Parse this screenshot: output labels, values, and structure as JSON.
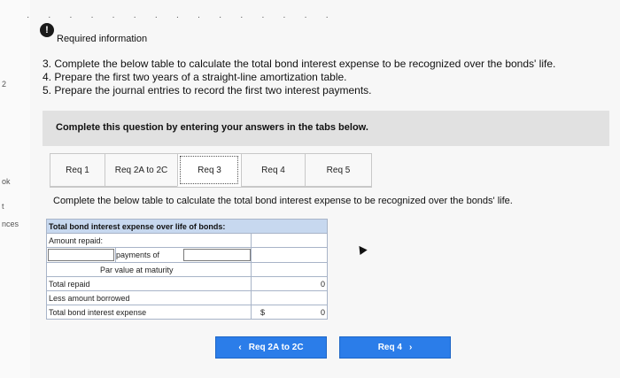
{
  "sidebar": {
    "fragments": [
      "2",
      "ok",
      "t",
      "nces"
    ]
  },
  "header": {
    "info_icon": "!",
    "required_info": "Required information"
  },
  "instructions": [
    "3. Complete the below table to calculate the total bond interest expense to be recognized over the bonds' life.",
    "4. Prepare the first two years of a straight-line amortization table.",
    "5. Prepare the journal entries to record the first two interest payments."
  ],
  "banner": "Complete this question by entering your answers in the tabs below.",
  "tabs": [
    {
      "label": "Req 1",
      "active": false
    },
    {
      "label": "Req 2A to 2C",
      "active": false
    },
    {
      "label": "Req 3",
      "active": true
    },
    {
      "label": "Req 4",
      "active": false
    },
    {
      "label": "Req 5",
      "active": false
    }
  ],
  "question": "Complete the below table to calculate the total bond interest expense to be recognized over the bonds' life.",
  "table": {
    "header": "Total bond interest expense over life of bonds:",
    "amount_repaid": "Amount repaid:",
    "payments_of": "payments of",
    "par_value": "Par value at maturity",
    "total_repaid": "Total repaid",
    "total_repaid_value": "0",
    "less_borrowed": "Less amount borrowed",
    "total_interest": "Total bond interest expense",
    "total_interest_currency": "$",
    "total_interest_value": "0"
  },
  "nav": {
    "prev_label": "Req 2A to 2C",
    "next_label": "Req 4"
  },
  "colors": {
    "accent": "#2b7de9",
    "table_header": "#c7d8ef"
  }
}
